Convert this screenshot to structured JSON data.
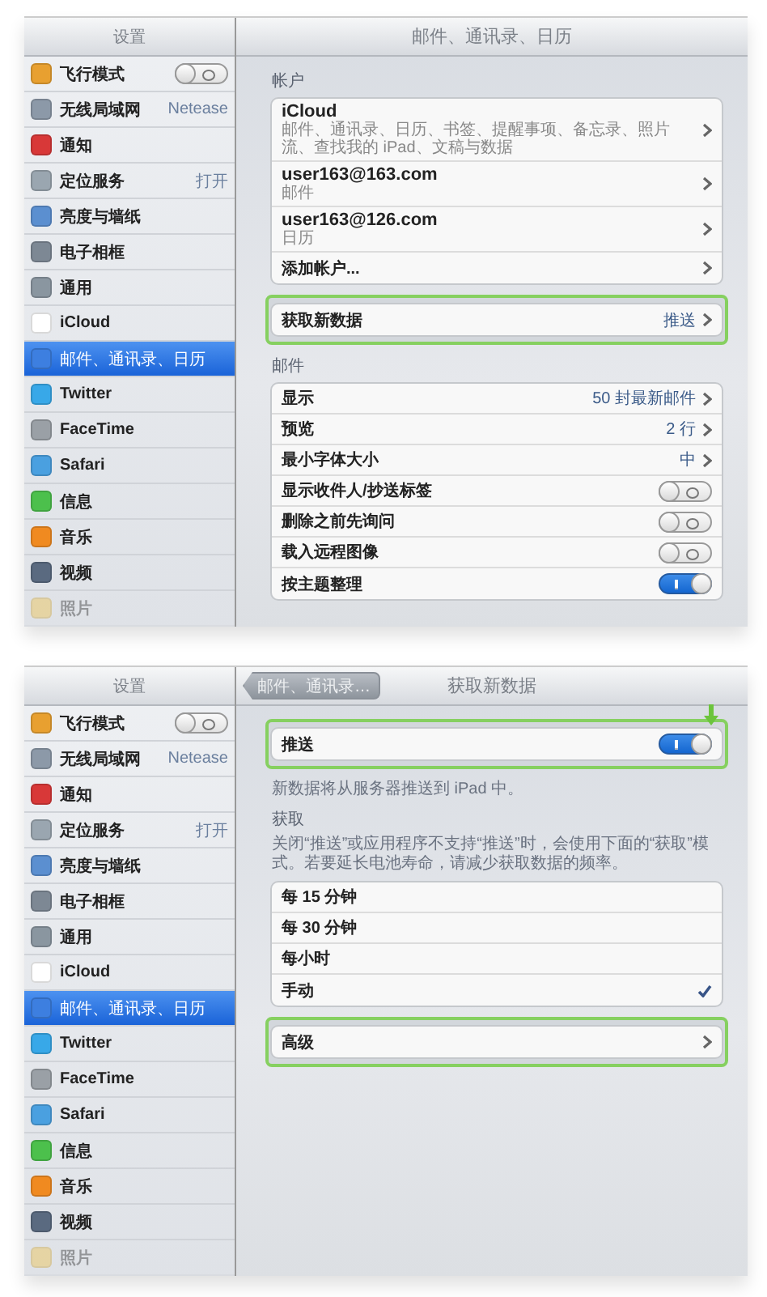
{
  "panels": [
    {
      "sidebar_title": "设置",
      "title": "邮件、通讯录、日历",
      "sidebar": [
        {
          "label": "飞行模式",
          "kind": "toggle",
          "on": false,
          "selected": false
        },
        {
          "label": "无线局域网",
          "kind": "value",
          "value": "Netease",
          "selected": false
        },
        {
          "label": "通知",
          "kind": "plain",
          "selected": false
        },
        {
          "label": "定位服务",
          "kind": "value",
          "value": "打开",
          "selected": false
        },
        {
          "label": "亮度与墙纸",
          "kind": "plain",
          "selected": false
        },
        {
          "label": "电子相框",
          "kind": "plain",
          "selected": false
        },
        {
          "label": "通用",
          "kind": "plain",
          "selected": false
        },
        {
          "label": "iCloud",
          "kind": "plain",
          "selected": false
        },
        {
          "label": "邮件、通讯录、日历",
          "kind": "plain",
          "selected": true
        },
        {
          "label": "Twitter",
          "kind": "plain",
          "selected": false
        },
        {
          "label": "FaceTime",
          "kind": "plain",
          "selected": false
        },
        {
          "label": "Safari",
          "kind": "plain",
          "selected": false
        },
        {
          "label": "信息",
          "kind": "plain",
          "selected": false
        },
        {
          "label": "音乐",
          "kind": "plain",
          "selected": false
        },
        {
          "label": "视频",
          "kind": "plain",
          "selected": false
        },
        {
          "label": "照片",
          "kind": "plain",
          "selected": false
        }
      ],
      "sections": [
        {
          "header": "帐户",
          "highlighted": false,
          "rows": [
            {
              "kind": "disclosure",
              "label": "iCloud",
              "subtitle": "邮件、通讯录、日历、书签、提醒事项、备忘录、照片流、查找我的 iPad、文稿与数据"
            },
            {
              "kind": "disclosure",
              "label": "user163@163.com",
              "subtitle": "邮件"
            },
            {
              "kind": "disclosure",
              "label": "user163@126.com",
              "subtitle": "日历"
            },
            {
              "kind": "disclosure",
              "label": "添加帐户..."
            }
          ]
        },
        {
          "highlighted": true,
          "rows": [
            {
              "kind": "disclosure",
              "label": "获取新数据",
              "value": "推送"
            }
          ]
        },
        {
          "header": "邮件",
          "highlighted": false,
          "rows": [
            {
              "kind": "disclosure",
              "label": "显示",
              "value": "50 封最新邮件"
            },
            {
              "kind": "disclosure",
              "label": "预览",
              "value": "2 行"
            },
            {
              "kind": "disclosure",
              "label": "最小字体大小",
              "value": "中"
            },
            {
              "kind": "toggle",
              "label": "显示收件人/抄送标签",
              "on": false
            },
            {
              "kind": "toggle",
              "label": "删除之前先询问",
              "on": false
            },
            {
              "kind": "toggle",
              "label": "载入远程图像",
              "on": false
            },
            {
              "kind": "toggle",
              "label": "按主题整理",
              "on": true
            }
          ]
        }
      ]
    },
    {
      "sidebar_title": "设置",
      "title": "获取新数据",
      "back_button": "邮件、通讯录…",
      "sidebar": [
        {
          "label": "飞行模式",
          "kind": "toggle",
          "on": false,
          "selected": false
        },
        {
          "label": "无线局域网",
          "kind": "value",
          "value": "Netease",
          "selected": false
        },
        {
          "label": "通知",
          "kind": "plain",
          "selected": false
        },
        {
          "label": "定位服务",
          "kind": "value",
          "value": "打开",
          "selected": false
        },
        {
          "label": "亮度与墙纸",
          "kind": "plain",
          "selected": false
        },
        {
          "label": "电子相框",
          "kind": "plain",
          "selected": false
        },
        {
          "label": "通用",
          "kind": "plain",
          "selected": false
        },
        {
          "label": "iCloud",
          "kind": "plain",
          "selected": false
        },
        {
          "label": "邮件、通讯录、日历",
          "kind": "plain",
          "selected": true
        },
        {
          "label": "Twitter",
          "kind": "plain",
          "selected": false
        },
        {
          "label": "FaceTime",
          "kind": "plain",
          "selected": false
        },
        {
          "label": "Safari",
          "kind": "plain",
          "selected": false
        },
        {
          "label": "信息",
          "kind": "plain",
          "selected": false
        },
        {
          "label": "音乐",
          "kind": "plain",
          "selected": false
        },
        {
          "label": "视频",
          "kind": "plain",
          "selected": false
        },
        {
          "label": "照片",
          "kind": "plain",
          "selected": false
        }
      ],
      "sections": [
        {
          "highlighted": true,
          "footer": "新数据将从服务器推送到 iPad 中。",
          "rows": [
            {
              "kind": "toggle",
              "label": "推送",
              "on": true,
              "pointer": true
            }
          ]
        },
        {
          "header": "获取",
          "note": "关闭“推送”或应用程序不支持“推送”时，会使用下面的“获取”模式。若要延长电池寿命，请减少获取数据的频率。",
          "highlighted": false,
          "rows": [
            {
              "kind": "check",
              "label": "每 15 分钟",
              "checked": false
            },
            {
              "kind": "check",
              "label": "每 30 分钟",
              "checked": false
            },
            {
              "kind": "check",
              "label": "每小时",
              "checked": false
            },
            {
              "kind": "check",
              "label": "手动",
              "checked": true
            }
          ]
        },
        {
          "highlighted": true,
          "rows": [
            {
              "kind": "disclosure",
              "label": "高级"
            }
          ]
        }
      ]
    }
  ]
}
